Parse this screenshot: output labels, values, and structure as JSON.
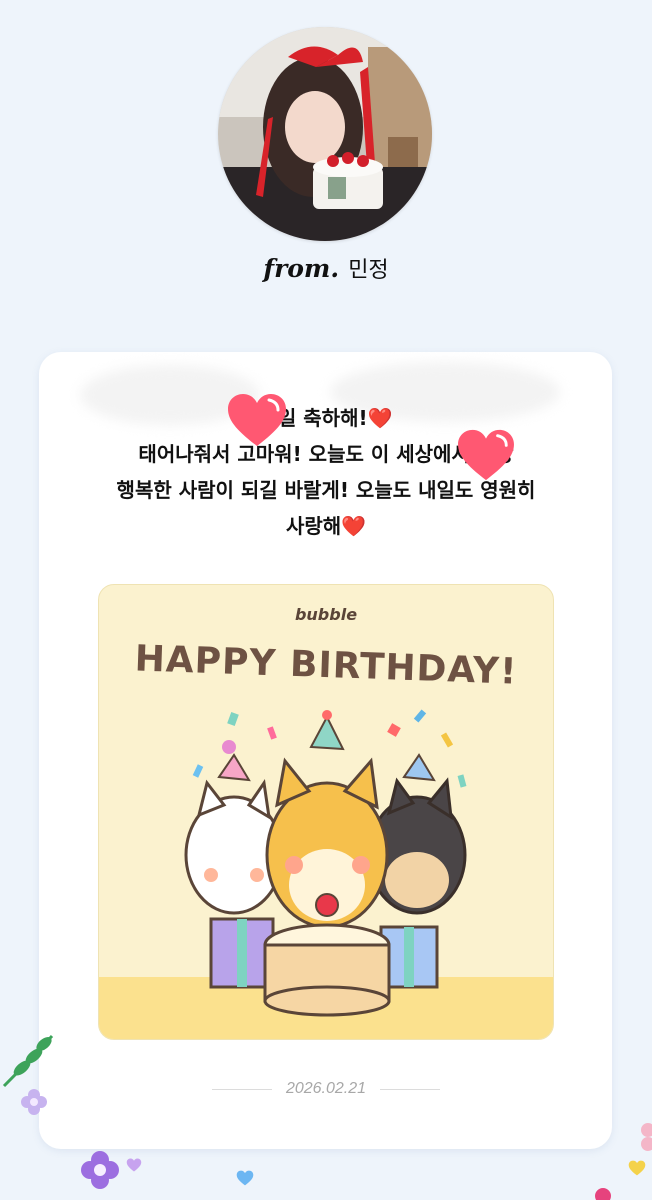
{
  "sender": {
    "from_word": "from.",
    "name": "민정"
  },
  "message": {
    "lines": [
      "생일 축하해!❤️",
      "태어나줘서 고마워! 오늘도 이 세상에서 가장",
      "행복한 사람이 되길 바랄게! 오늘도 내일도 영원히",
      "사랑해❤️"
    ]
  },
  "sticker": {
    "brand": "bubble",
    "headline": "HAPPY BIRTHDAY!"
  },
  "date": "2026.02.21",
  "colors": {
    "background": "#eef4fb",
    "card": "#ffffff",
    "heart": "#ff4d6d",
    "sticker_bg": "#fbf2cf",
    "headline": "#6e5243"
  }
}
